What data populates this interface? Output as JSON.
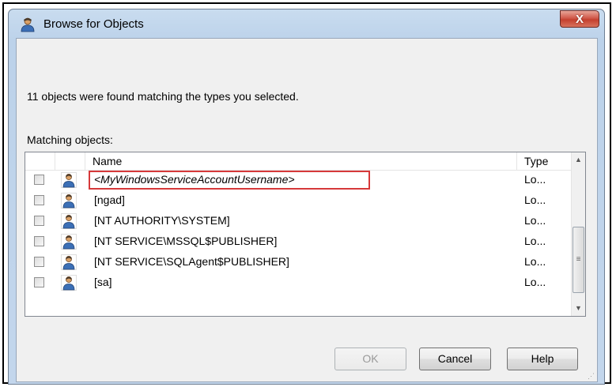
{
  "window": {
    "title": "Browse for Objects",
    "close_label": "X",
    "title_icon": "user-icon"
  },
  "summary_text": "11 objects were found matching the types you selected.",
  "matching_label": "Matching objects:",
  "table": {
    "columns": [
      "Name",
      "Type"
    ],
    "rows": [
      {
        "name": "<MyWindowsServiceAccountUsername>",
        "type": "Lo...",
        "checked": false,
        "highlighted": true
      },
      {
        "name": "[ngad]",
        "type": "Lo...",
        "checked": false
      },
      {
        "name": "[NT AUTHORITY\\SYSTEM]",
        "type": "Lo...",
        "checked": false
      },
      {
        "name": "[NT SERVICE\\MSSQL$PUBLISHER]",
        "type": "Lo...",
        "checked": false
      },
      {
        "name": "[NT SERVICE\\SQLAgent$PUBLISHER]",
        "type": "Lo...",
        "checked": false
      },
      {
        "name": "[sa]",
        "type": "Lo...",
        "checked": false
      }
    ],
    "row_icon": "user-icon",
    "highlight_color": "#d6393a"
  },
  "scrollbar": {
    "up": "▲",
    "down": "▼",
    "grip": "≡"
  },
  "buttons": {
    "ok": "OK",
    "cancel": "Cancel",
    "help": "Help"
  },
  "colors": {
    "titlebar": "#bcd2ea",
    "close": "#c4402e",
    "client": "#f0f0f0"
  }
}
